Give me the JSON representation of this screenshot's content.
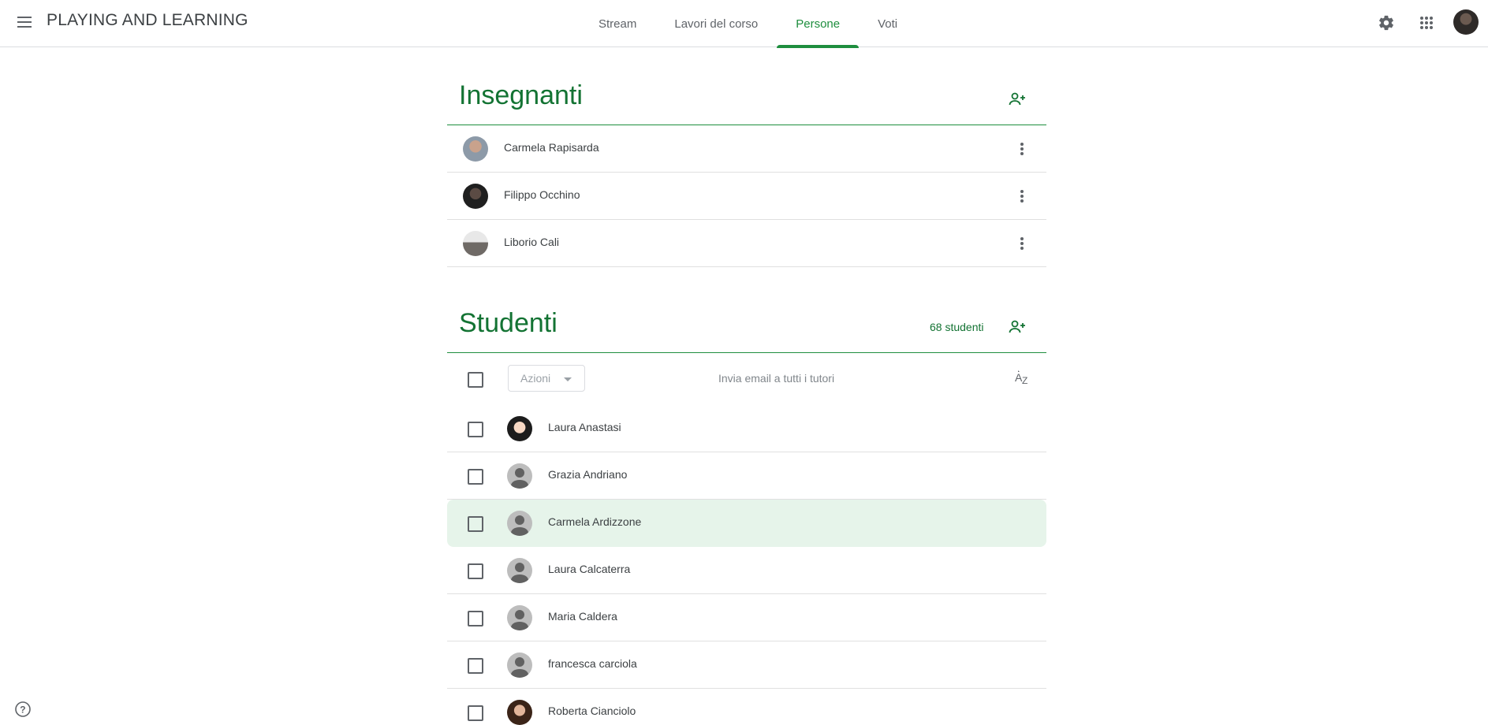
{
  "header": {
    "app_title": "PLAYING AND LEARNING",
    "tabs": [
      {
        "label": "Stream",
        "active": false
      },
      {
        "label": "Lavori del corso",
        "active": false
      },
      {
        "label": "Persone",
        "active": true
      },
      {
        "label": "Voti",
        "active": false
      }
    ],
    "icons": [
      "menu-icon",
      "settings-gear-icon",
      "apps-grid-icon",
      "account-avatar"
    ]
  },
  "teachers": {
    "title": "Insegnanti",
    "items": [
      {
        "name": "Carmela Rapisarda"
      },
      {
        "name": "Filippo Occhino"
      },
      {
        "name": "Liborio Cali"
      }
    ]
  },
  "students": {
    "title": "Studenti",
    "count_label": "68 studenti",
    "actions_label": "Azioni",
    "email_all_label": "Invia email a tutti i tutori",
    "items": [
      {
        "name": "Laura Anastasi",
        "avatar": "photo"
      },
      {
        "name": "Grazia Andriano",
        "avatar": "default"
      },
      {
        "name": "Carmela Ardizzone",
        "avatar": "default",
        "highlighted": true
      },
      {
        "name": "Laura Calcaterra",
        "avatar": "default"
      },
      {
        "name": "Maria Caldera",
        "avatar": "default"
      },
      {
        "name": "francesca carciola",
        "avatar": "default"
      },
      {
        "name": "Roberta Cianciolo",
        "avatar": "photo"
      }
    ]
  },
  "colors": {
    "accent": "#1e8e3e",
    "highlight_row": "#e6f4ea",
    "divider": "#e0e0e0"
  }
}
